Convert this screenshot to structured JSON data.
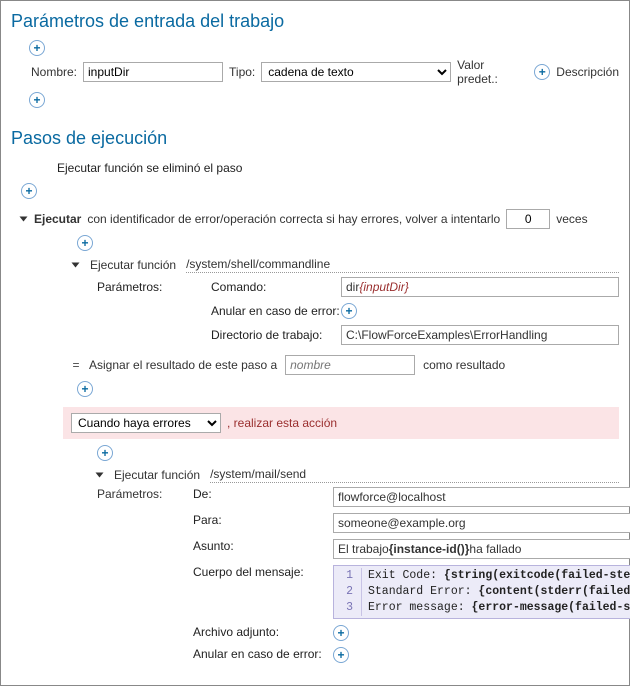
{
  "section1": {
    "title": "Parámetros de entrada del trabajo",
    "name_label": "Nombre:",
    "name_value": "inputDir",
    "type_label": "Tipo:",
    "type_value": "cadena de texto",
    "default_label": "Valor predet.:",
    "desc_label": "Descripción"
  },
  "section2": {
    "title": "Pasos de ejecución",
    "deleted_step_text": "Ejecutar función se eliminó el paso",
    "exec_label": "Ejecutar",
    "retry_text_1": " con identificador de error/operación correcta si hay errores, volver a intentarlo",
    "retry_value": "0",
    "retry_text_2": "veces",
    "step1": {
      "exec_fn_label": "Ejecutar función",
      "fn_path": "/system/shell/commandline",
      "params_label": "Parámetros:",
      "cmd_label": "Comando:",
      "cmd_prefix": "dir",
      "cmd_var": "{inputDir}",
      "abort_label": "Anular en caso de error:",
      "wd_label": "Directorio de trabajo:",
      "wd_value": "C:\\FlowForceExamples\\ErrorHandling",
      "assign_label": "Asignar el resultado de este paso a",
      "assign_placeholder": "nombre",
      "assign_suffix": "como resultado"
    },
    "error_bar": {
      "select_value": "Cuando haya errores",
      "suffix": ", realizar esta acción"
    },
    "step2": {
      "exec_fn_label": "Ejecutar función",
      "fn_path": "/system/mail/send",
      "params_label": "Parámetros:",
      "from_label": "De:",
      "from_value": "flowforce@localhost",
      "to_label": "Para:",
      "to_value": "someone@example.org",
      "subject_label": "Asunto:",
      "subject_prefix": "El trabajo ",
      "subject_expr": "{instance-id()}",
      "subject_suffix": " ha fallado",
      "body_label": "Cuerpo del mensaje:",
      "body_lines": [
        {
          "n": "1",
          "text": "Exit Code: ",
          "expr": "{string(exitcode(failed-step()))}"
        },
        {
          "n": "2",
          "text": "Standard Error: ",
          "expr": "{content(stderr(failed-step()))}"
        },
        {
          "n": "3",
          "text": "Error message: ",
          "expr": "{error-message(failed-step())}"
        }
      ],
      "attach_label": "Archivo adjunto:",
      "abort_label": "Anular en caso de error:"
    }
  }
}
